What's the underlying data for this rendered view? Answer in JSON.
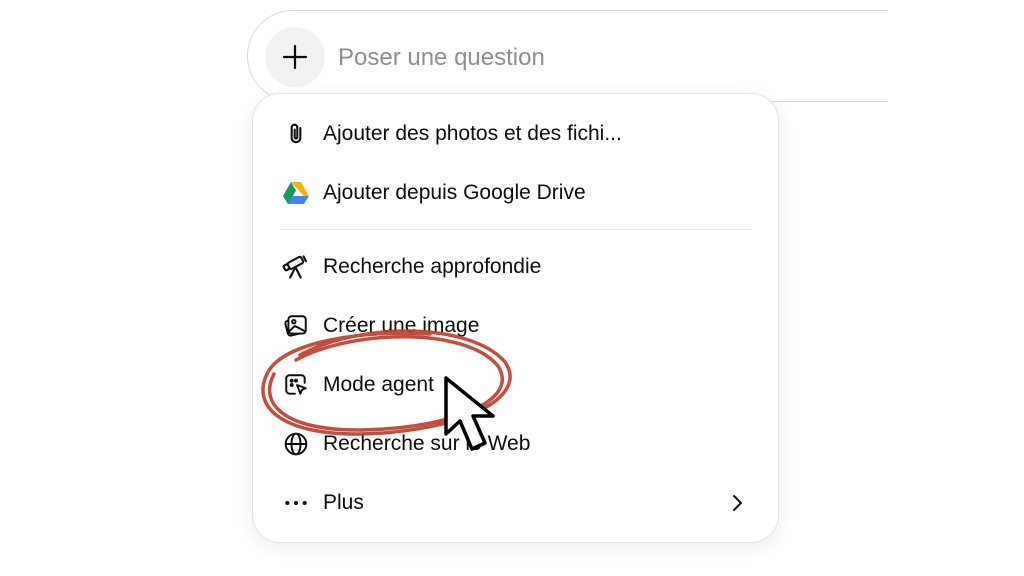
{
  "composer": {
    "placeholder": "Poser une question"
  },
  "menu": {
    "items": [
      {
        "label": "Ajouter des photos et des fichi...",
        "icon": "paperclip-icon"
      },
      {
        "label": "Ajouter depuis Google Drive",
        "icon": "google-drive-icon"
      },
      {
        "label": "Recherche approfondie",
        "icon": "telescope-icon"
      },
      {
        "label": "Créer une image",
        "icon": "image-icon"
      },
      {
        "label": "Mode agent",
        "icon": "agent-cursor-icon"
      },
      {
        "label": "Recherche sur le Web",
        "icon": "globe-icon"
      },
      {
        "label": "Plus",
        "icon": "ellipsis-icon"
      }
    ]
  },
  "colors": {
    "annotation_circle": "#c0392b",
    "drive_green": "#0f9d58",
    "drive_yellow": "#f4b400",
    "drive_blue": "#4285f4"
  }
}
